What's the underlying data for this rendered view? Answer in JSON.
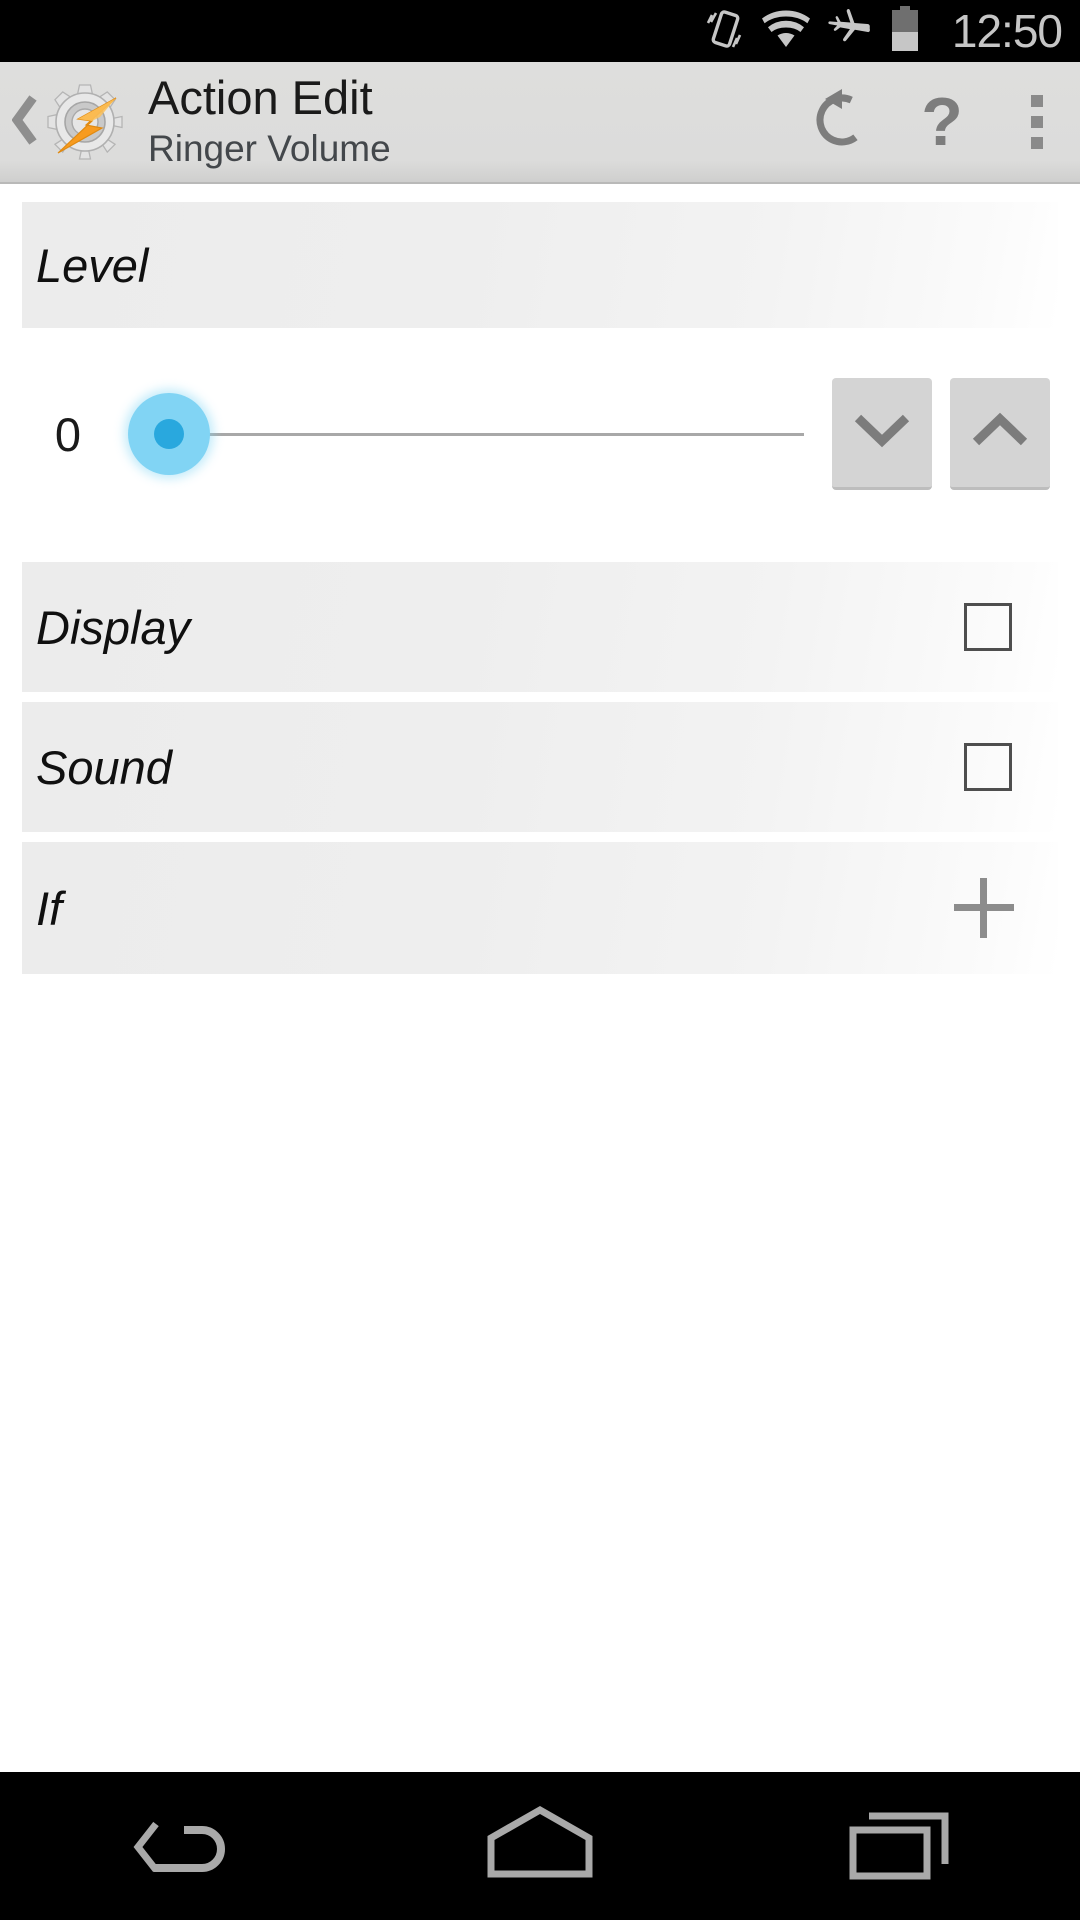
{
  "status_bar": {
    "clock": "12:50",
    "icons": [
      "vibrate-icon",
      "wifi-icon",
      "airplane-mode-icon",
      "battery-icon"
    ],
    "battery_level_percent": 45,
    "icon_color": "#c6c6c6",
    "background": "#000000"
  },
  "action_bar": {
    "back_icon": "back-chevron-icon",
    "app_icon": "tasker-gear-bolt-icon",
    "title": "Action Edit",
    "subtitle": "Ringer Volume",
    "actions": [
      {
        "name": "reset-action",
        "icon": "undo-rotate-left-icon",
        "label": ""
      },
      {
        "name": "help-action",
        "icon": "question-mark-icon",
        "label": "?"
      },
      {
        "name": "overflow-menu",
        "icon": "three-dots-vertical-icon",
        "label": ""
      }
    ],
    "background": "#dcdcdb",
    "title_color": "#1a1a1a",
    "subtitle_color": "#43474b"
  },
  "main": {
    "level_section": {
      "label": "Level",
      "value": "0",
      "slider": {
        "value": 0,
        "min": 0,
        "max": 7,
        "thumb_color": "#81d4f4",
        "thumb_center_color": "#29a8de",
        "track_color": "#a8a8a8",
        "fill_percent": 0
      },
      "stepper_down": {
        "icon": "chevron-down-icon",
        "label": ""
      },
      "stepper_up": {
        "icon": "chevron-up-icon",
        "label": ""
      }
    },
    "rows": [
      {
        "label": "Display",
        "control": "checkbox",
        "checked": false,
        "icon": "checkbox-unchecked-icon"
      },
      {
        "label": "Sound",
        "control": "checkbox",
        "checked": false,
        "icon": "checkbox-unchecked-icon"
      },
      {
        "label": "If",
        "control": "add",
        "icon": "plus-icon"
      }
    ],
    "row_background": "#ececec",
    "content_background": "#ffffff"
  },
  "nav_bar": {
    "buttons": [
      {
        "name": "back-button",
        "icon": "nav-back-arrow-icon"
      },
      {
        "name": "home-button",
        "icon": "nav-home-pentagon-icon"
      },
      {
        "name": "recents-button",
        "icon": "nav-recents-squares-icon"
      }
    ],
    "background": "#000000",
    "icon_color": "#a9a9a9"
  }
}
